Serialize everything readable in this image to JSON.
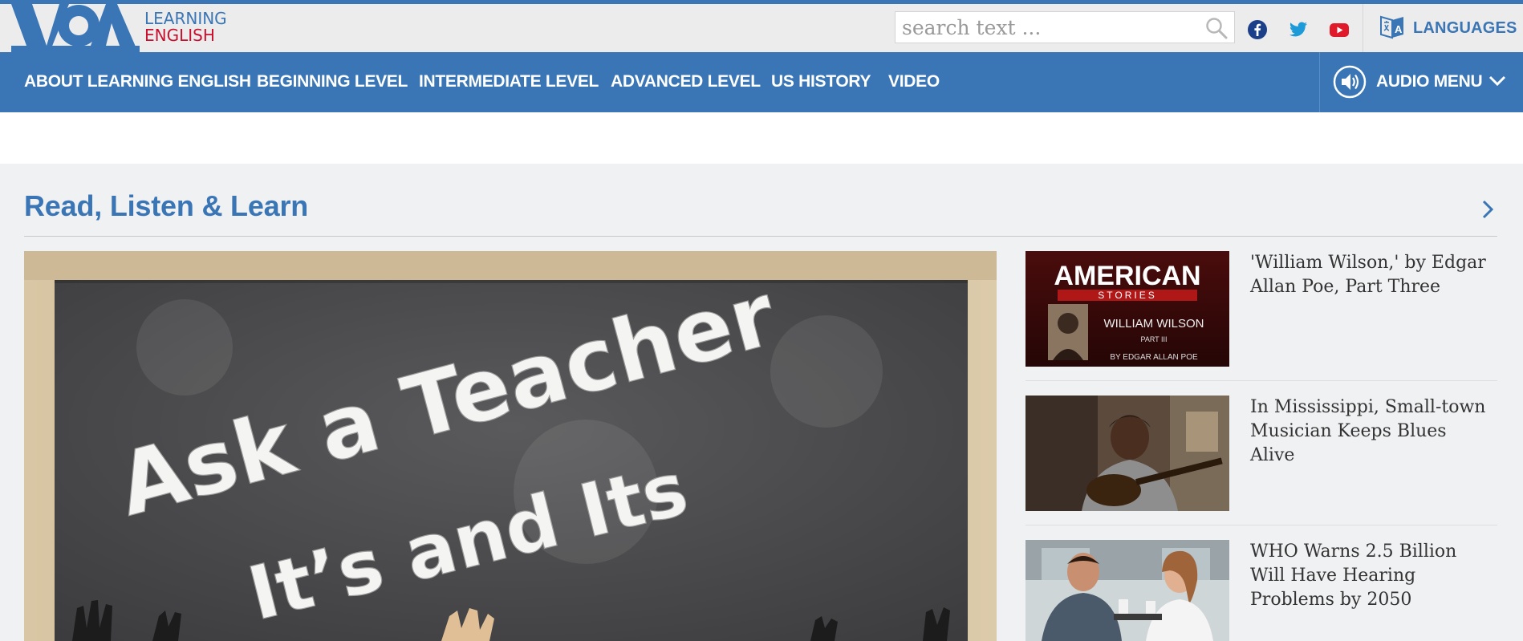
{
  "header": {
    "brand_line1": "LEARNING",
    "brand_line2": "ENGLISH",
    "search_placeholder": "search text ...",
    "languages_label": "LANGUAGES"
  },
  "nav": {
    "items": [
      {
        "label": "ABOUT LEARNING ENGLISH"
      },
      {
        "label": "BEGINNING LEVEL"
      },
      {
        "label": "INTERMEDIATE LEVEL"
      },
      {
        "label": "ADVANCED LEVEL"
      },
      {
        "label": "US HISTORY"
      },
      {
        "label": "VIDEO"
      }
    ],
    "audio_menu_label": "AUDIO MENU"
  },
  "section": {
    "title": "Read, Listen & Learn"
  },
  "hero": {
    "line1": "Ask a Teacher",
    "line2": "It’s and Its"
  },
  "cards": [
    {
      "title": "'William Wilson,' by Edgar Allan Poe, Part Three",
      "thumb_main": "AMERICAN",
      "thumb_banner": "STORIES",
      "thumb_name": "WILLIAM WILSON",
      "thumb_part": "PART III",
      "thumb_author": "BY EDGAR ALLAN POE"
    },
    {
      "title": "In Mississippi, Small-town Musician Keeps Blues Alive"
    },
    {
      "title": "WHO Warns 2.5 Billion Will Have Hearing Problems by 2050"
    }
  ],
  "colors": {
    "brand_blue": "#3a76b6",
    "brand_red": "#c8102e",
    "facebook": "#1c3f8a",
    "twitter": "#1d9bd8",
    "youtube": "#e01a2b"
  },
  "icons": {
    "search": "search-icon",
    "facebook": "facebook-icon",
    "twitter": "twitter-icon",
    "youtube": "youtube-icon",
    "languages": "languages-icon",
    "audio": "speaker-icon",
    "chevron": "chevron-down-icon",
    "arrow": "chevron-right-icon"
  }
}
